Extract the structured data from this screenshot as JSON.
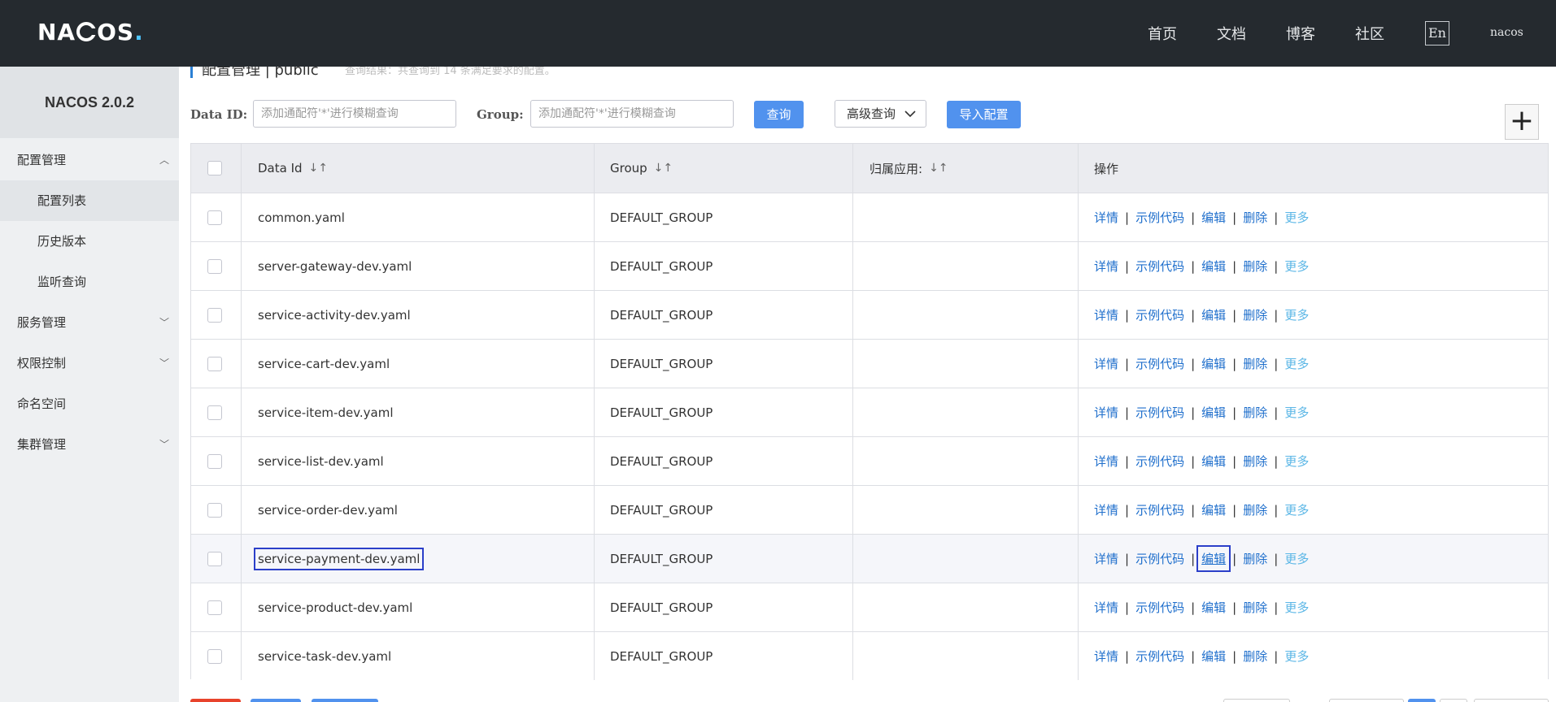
{
  "header": {
    "logo_text_1": "NA",
    "logo_text_2": "OS",
    "logo_dot": ".",
    "nav": [
      "首页",
      "文档",
      "博客",
      "社区"
    ],
    "lang_button": "En",
    "user": "nacos"
  },
  "sidebar": {
    "version": "NACOS 2.0.2",
    "items": [
      {
        "label": "配置管理",
        "expanded": true
      },
      {
        "label": "配置列表",
        "sub": true,
        "active": true
      },
      {
        "label": "历史版本",
        "sub": true
      },
      {
        "label": "监听查询",
        "sub": true
      },
      {
        "label": "服务管理",
        "expanded": false
      },
      {
        "label": "权限控制",
        "expanded": false
      },
      {
        "label": "命名空间"
      },
      {
        "label": "集群管理",
        "expanded": false
      }
    ]
  },
  "page": {
    "breadcrumb": "配置管理  |  public",
    "hint": "查询结果：共查询到 14 条满足要求的配置。"
  },
  "search": {
    "dataid_label": "Data ID:",
    "dataid_placeholder": "添加通配符'*'进行模糊查询",
    "group_label": "Group:",
    "group_placeholder": "添加通配符'*'进行模糊查询",
    "query_button": "查询",
    "advanced_button": "高级查询",
    "import_button": "导入配置",
    "add_button": "+"
  },
  "table": {
    "columns": [
      "Data Id",
      "Group",
      "归属应用:",
      "操作"
    ],
    "actions": [
      "详情",
      "示例代码",
      "编辑",
      "删除",
      "更多"
    ],
    "rows": [
      {
        "data_id": "common.yaml",
        "group": "DEFAULT_GROUP",
        "app": ""
      },
      {
        "data_id": "server-gateway-dev.yaml",
        "group": "DEFAULT_GROUP",
        "app": ""
      },
      {
        "data_id": "service-activity-dev.yaml",
        "group": "DEFAULT_GROUP",
        "app": ""
      },
      {
        "data_id": "service-cart-dev.yaml",
        "group": "DEFAULT_GROUP",
        "app": ""
      },
      {
        "data_id": "service-item-dev.yaml",
        "group": "DEFAULT_GROUP",
        "app": ""
      },
      {
        "data_id": "service-list-dev.yaml",
        "group": "DEFAULT_GROUP",
        "app": ""
      },
      {
        "data_id": "service-order-dev.yaml",
        "group": "DEFAULT_GROUP",
        "app": ""
      },
      {
        "data_id": "service-payment-dev.yaml",
        "group": "DEFAULT_GROUP",
        "app": "",
        "highlighted": true
      },
      {
        "data_id": "service-product-dev.yaml",
        "group": "DEFAULT_GROUP",
        "app": ""
      },
      {
        "data_id": "service-task-dev.yaml",
        "group": "DEFAULT_GROUP",
        "app": ""
      }
    ]
  },
  "colors": {
    "header_bg": "#252a2f",
    "primary": "#5192ee",
    "link": "#1f6fcc",
    "more_link": "#5ab6e6",
    "highlight_box": "#2b3fc9"
  }
}
